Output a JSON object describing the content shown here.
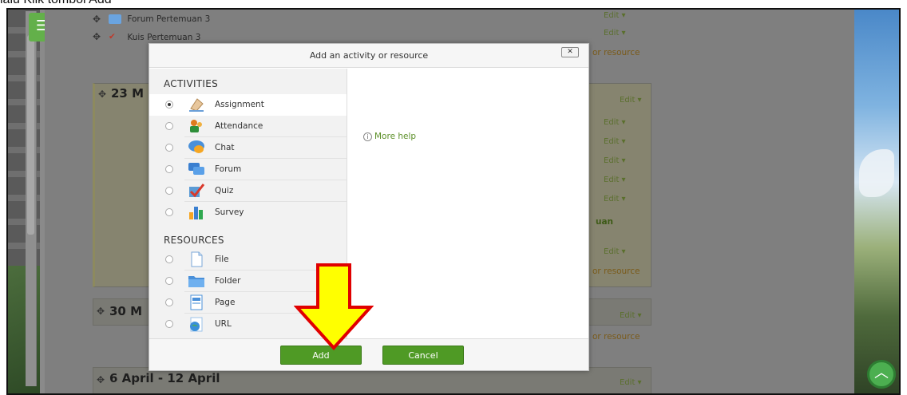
{
  "caption": "lalu Klik tombol Add",
  "page": {
    "top_items": [
      {
        "label": "Forum Pertemuan 3"
      },
      {
        "label": "Kuis Pertemuan 3"
      }
    ],
    "edit_label": "Edit ▾",
    "add_resource_fragment": "or resource",
    "section_fragment": "uan",
    "sections": [
      {
        "title": "23 M"
      },
      {
        "title": "30 M"
      },
      {
        "title": "6 April - 12 April"
      }
    ]
  },
  "dialog": {
    "title": "Add an activity or resource",
    "close_label": "✕",
    "activities_heading": "ACTIVITIES",
    "resources_heading": "RESOURCES",
    "activities": [
      {
        "label": "Assignment",
        "icon": "assignment-icon",
        "selected": true
      },
      {
        "label": "Attendance",
        "icon": "attendance-icon"
      },
      {
        "label": "Chat",
        "icon": "chat-icon"
      },
      {
        "label": "Forum",
        "icon": "forum-icon"
      },
      {
        "label": "Quiz",
        "icon": "quiz-icon"
      },
      {
        "label": "Survey",
        "icon": "survey-icon"
      }
    ],
    "resources": [
      {
        "label": "File",
        "icon": "file-icon"
      },
      {
        "label": "Folder",
        "icon": "folder-icon"
      },
      {
        "label": "Page",
        "icon": "page-icon"
      },
      {
        "label": "URL",
        "icon": "url-icon"
      }
    ],
    "help_label": "More help",
    "add_label": "Add",
    "cancel_label": "Cancel"
  },
  "colors": {
    "accent_green": "#4f9a25",
    "arrow_fill": "#ffff00",
    "arrow_stroke": "#e00000"
  }
}
